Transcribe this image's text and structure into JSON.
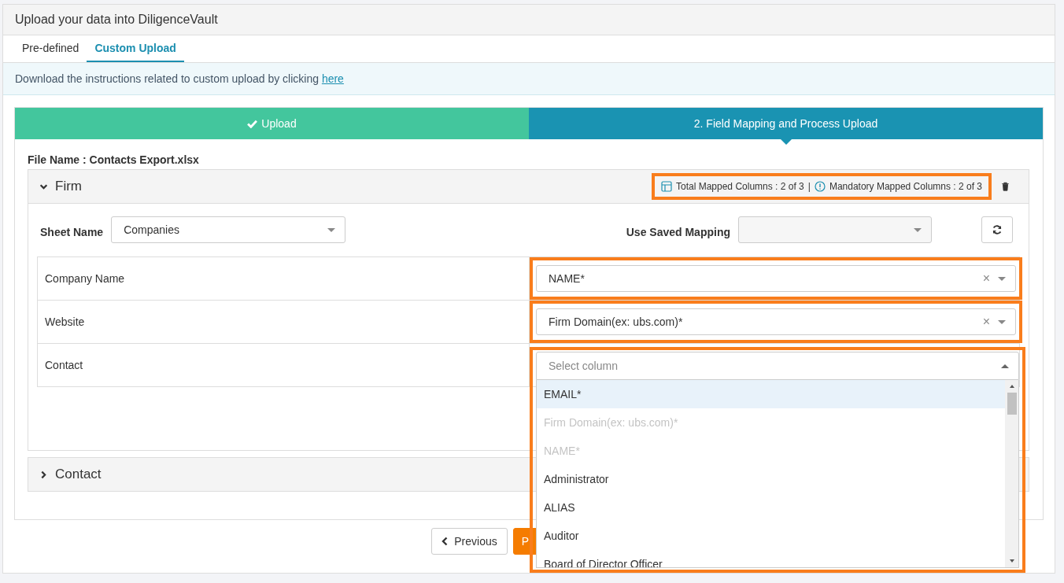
{
  "title": "Upload your data into DiligenceVault",
  "tabs": [
    {
      "label": "Pre-defined",
      "selected": false
    },
    {
      "label": "Custom Upload",
      "selected": true
    }
  ],
  "notice": {
    "text": "Download the instructions related to custom upload by clicking",
    "link": "here"
  },
  "steps": [
    {
      "label": "Upload",
      "done": true,
      "active": false
    },
    {
      "label": "2. Field Mapping and Process Upload",
      "done": false,
      "active": true
    }
  ],
  "file_name": "File Name : Contacts Export.xlsx",
  "sections": [
    {
      "title": "Firm",
      "expanded": true,
      "summary": {
        "total": "Total Mapped Columns : 2 of 3",
        "separator": "|",
        "mandatory": "Mandatory Mapped Columns : 2 of 3",
        "highlighted": true
      },
      "sheet_label": "Sheet Name",
      "sheet_value": "Companies",
      "saved_label": "Use Saved Mapping",
      "fields": [
        {
          "name": "Company Name",
          "value": "NAME*",
          "clear": "×",
          "highlighted": true,
          "expanded": false
        },
        {
          "name": "Website",
          "value": "Firm Domain(ex: ubs.com)*",
          "clear": "×",
          "highlighted": true,
          "expanded": false
        },
        {
          "name": "Contact",
          "placeholder": "Select column",
          "highlighted": true,
          "expanded": true,
          "options": [
            {
              "label": "EMAIL*",
              "hovered": true,
              "disabled": false
            },
            {
              "label": "Firm Domain(ex: ubs.com)*",
              "hovered": false,
              "disabled": true
            },
            {
              "label": "NAME*",
              "hovered": false,
              "disabled": true
            },
            {
              "label": "Administrator",
              "hovered": false,
              "disabled": false
            },
            {
              "label": "ALIAS",
              "hovered": false,
              "disabled": false
            },
            {
              "label": "Auditor",
              "hovered": false,
              "disabled": false
            },
            {
              "label": "Board of Director Officer",
              "hovered": false,
              "disabled": false
            }
          ]
        }
      ]
    },
    {
      "title": "Contact",
      "expanded": false
    }
  ],
  "buttons": [
    {
      "label": "Previous",
      "kind": "back"
    },
    {
      "label": "P",
      "kind": "primary"
    }
  ]
}
